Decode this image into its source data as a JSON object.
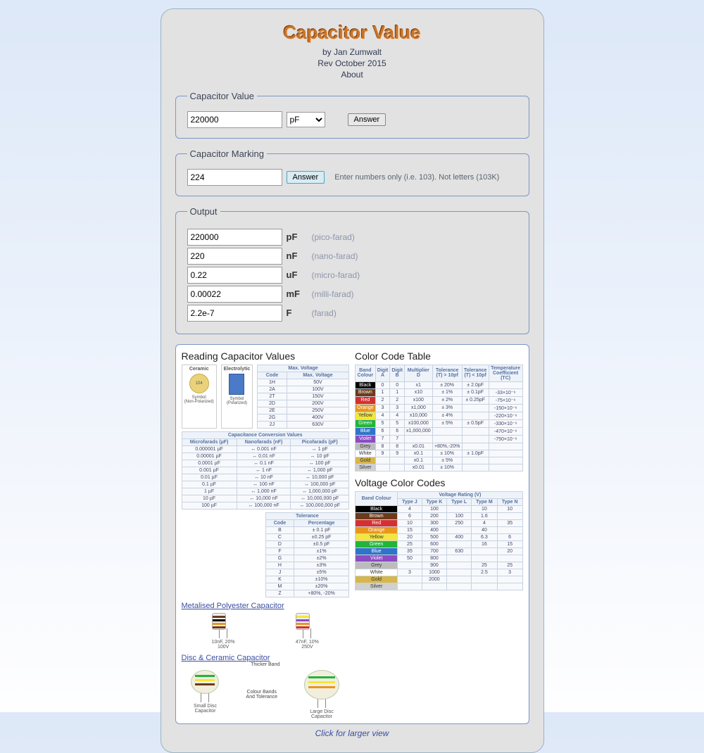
{
  "title": "Capacitor Value",
  "author": "by Jan Zumwalt",
  "rev": "Rev October 2015",
  "about": "About",
  "sections": {
    "value": {
      "legend": "Capacitor Value",
      "input": "220000",
      "unit_selected": "pF",
      "unit_options": [
        "pF",
        "nF",
        "uF",
        "mF",
        "F"
      ],
      "button": "Answer"
    },
    "marking": {
      "legend": "Capacitor Marking",
      "input": "224",
      "button": "Answer",
      "hint": "Enter numbers only (i.e. 103). Not letters (103K)"
    },
    "output": {
      "legend": "Output",
      "rows": [
        {
          "val": "220000",
          "unit": "pF",
          "desc": "(pico-farad)"
        },
        {
          "val": "220",
          "unit": "nF",
          "desc": "(nano-farad)"
        },
        {
          "val": "0.22",
          "unit": "uF",
          "desc": "(micro-farad)"
        },
        {
          "val": "0.00022",
          "unit": "mF",
          "desc": "(milli-farad)"
        },
        {
          "val": "2.2e-7",
          "unit": "F",
          "desc": "(farad)"
        }
      ]
    }
  },
  "reference": {
    "reading_heading": "Reading Capacitor Values",
    "colorcode_heading": "Color Code Table",
    "voltage_heading": "Voltage Color Codes",
    "link_poly": "Metalised Polyester Capacitor",
    "link_disc": "Disc & Ceramic Capacitor",
    "click_larger": "Click for larger view",
    "ceramic_label": "Ceramic",
    "electrolytic_label": "Electrolytic",
    "symbol_np": "Symbol\n(Non-Polarized)",
    "symbol_p": "Symbol\n(Polarized)",
    "maxv": {
      "title": "Max. Voltage",
      "cols": [
        "Code",
        "Max. Voltage"
      ],
      "rows": [
        [
          "1H",
          "50V"
        ],
        [
          "2A",
          "100V"
        ],
        [
          "2T",
          "150V"
        ],
        [
          "2D",
          "200V"
        ],
        [
          "2E",
          "250V"
        ],
        [
          "2G",
          "400V"
        ],
        [
          "2J",
          "630V"
        ]
      ]
    },
    "tolerance": {
      "title": "Tolerance",
      "cols": [
        "Code",
        "Percentage"
      ],
      "rows": [
        [
          "B",
          "± 0.1 pF"
        ],
        [
          "C",
          "±0.25 pF"
        ],
        [
          "D",
          "±0.5 pF"
        ],
        [
          "F",
          "±1%"
        ],
        [
          "G",
          "±2%"
        ],
        [
          "H",
          "±3%"
        ],
        [
          "J",
          "±5%"
        ],
        [
          "K",
          "±10%"
        ],
        [
          "M",
          "±20%"
        ],
        [
          "Z",
          "+80%, -20%"
        ]
      ]
    },
    "conversion": {
      "title": "Capacitance Conversion Values",
      "cols": [
        "Microfarads (µF)",
        "Nanofarads (nF)",
        "Picofarads (pF)"
      ],
      "rows": [
        [
          "0.000001 µF",
          "↔ 0.001 nF",
          "↔ 1 pF"
        ],
        [
          "0.00001 µF",
          "↔ 0.01 nF",
          "↔ 10 pF"
        ],
        [
          "0.0001 µF",
          "↔ 0.1 nF",
          "↔ 100 pF"
        ],
        [
          "0.001 µF",
          "↔ 1 nF",
          "↔ 1,000 pF"
        ],
        [
          "0.01 µF",
          "↔ 10 nF",
          "↔ 10,000 pF"
        ],
        [
          "0.1 µF",
          "↔ 100 nF",
          "↔ 100,000 pF"
        ],
        [
          "1 µF",
          "↔ 1,000 nF",
          "↔ 1,000,000 pF"
        ],
        [
          "10 µF",
          "↔ 10,000 nF",
          "↔ 10,000,000 pF"
        ],
        [
          "100 µF",
          "↔ 100,000 nF",
          "↔ 100,000,000 pF"
        ]
      ]
    },
    "colorcode": {
      "cols": [
        "Band Colour",
        "Digit A",
        "Digit B",
        "Multiplier D",
        "Tolerance (T) > 10pf",
        "Tolerance (T) < 10pf",
        "Temperature Coefficient (TC)"
      ],
      "rows": [
        {
          "class": "cc-black",
          "cells": [
            "Black",
            "0",
            "0",
            "x1",
            "± 20%",
            "± 2.0pF",
            ""
          ]
        },
        {
          "class": "cc-brown",
          "cells": [
            "Brown",
            "1",
            "1",
            "x10",
            "± 1%",
            "± 0.1pF",
            "-33×10⁻⁶"
          ]
        },
        {
          "class": "cc-red",
          "cells": [
            "Red",
            "2",
            "2",
            "x100",
            "± 2%",
            "± 0.25pF",
            "-75×10⁻⁶"
          ]
        },
        {
          "class": "cc-orange",
          "cells": [
            "Orange",
            "3",
            "3",
            "x1,000",
            "± 3%",
            "",
            "-150×10⁻⁶"
          ]
        },
        {
          "class": "cc-yellow",
          "cells": [
            "Yellow",
            "4",
            "4",
            "x10,000",
            "± 4%",
            "",
            "-220×10⁻⁶"
          ]
        },
        {
          "class": "cc-green",
          "cells": [
            "Green",
            "5",
            "5",
            "x100,000",
            "± 5%",
            "± 0.5pF",
            "-330×10⁻⁶"
          ]
        },
        {
          "class": "cc-blue",
          "cells": [
            "Blue",
            "6",
            "6",
            "x1,000,000",
            "",
            "",
            "-470×10⁻⁶"
          ]
        },
        {
          "class": "cc-violet",
          "cells": [
            "Violet",
            "7",
            "7",
            "",
            "",
            "",
            "-750×10⁻⁶"
          ]
        },
        {
          "class": "cc-grey",
          "cells": [
            "Grey",
            "8",
            "8",
            "x0.01",
            "+80%,-20%",
            "",
            ""
          ]
        },
        {
          "class": "cc-white",
          "cells": [
            "White",
            "9",
            "9",
            "x0.1",
            "± 10%",
            "± 1.0pF",
            ""
          ]
        },
        {
          "class": "cc-gold",
          "cells": [
            "Gold",
            "",
            "",
            "x0.1",
            "± 5%",
            "",
            ""
          ]
        },
        {
          "class": "cc-silver",
          "cells": [
            "Silver",
            "",
            "",
            "x0.01",
            "± 10%",
            "",
            ""
          ]
        }
      ]
    },
    "voltage": {
      "group_header": "Voltage Rating (V)",
      "cols": [
        "Band Colour",
        "Type J",
        "Type K",
        "Type L",
        "Type M",
        "Type N"
      ],
      "rows": [
        {
          "class": "cc-black",
          "cells": [
            "Black",
            "4",
            "100",
            "",
            "10",
            "10"
          ]
        },
        {
          "class": "cc-brown",
          "cells": [
            "Brown",
            "6",
            "200",
            "100",
            "1.6",
            ""
          ]
        },
        {
          "class": "cc-red",
          "cells": [
            "Red",
            "10",
            "300",
            "250",
            "4",
            "35"
          ]
        },
        {
          "class": "cc-orange",
          "cells": [
            "Orange",
            "15",
            "400",
            "",
            "40",
            ""
          ]
        },
        {
          "class": "cc-yellow",
          "cells": [
            "Yellow",
            "20",
            "500",
            "400",
            "6.3",
            "6"
          ]
        },
        {
          "class": "cc-green",
          "cells": [
            "Green",
            "25",
            "600",
            "",
            "16",
            "15"
          ]
        },
        {
          "class": "cc-blue",
          "cells": [
            "Blue",
            "35",
            "700",
            "630",
            "",
            "20"
          ]
        },
        {
          "class": "cc-violet",
          "cells": [
            "Violet",
            "50",
            "800",
            "",
            "",
            ""
          ]
        },
        {
          "class": "cc-grey",
          "cells": [
            "Grey",
            "",
            "900",
            "",
            "25",
            "25"
          ]
        },
        {
          "class": "cc-white",
          "cells": [
            "White",
            "3",
            "1000",
            "",
            "2.5",
            "3"
          ]
        },
        {
          "class": "cc-gold",
          "cells": [
            "Gold",
            "",
            "2000",
            "",
            "",
            ""
          ]
        },
        {
          "class": "cc-silver",
          "cells": [
            "Silver",
            "",
            "",
            "",
            "",
            ""
          ]
        }
      ]
    },
    "poly_examples": [
      {
        "caption": "10nF, 20%\n100V"
      },
      {
        "caption": "47nF, 10%\n250V"
      }
    ],
    "disc_labels": {
      "thicker": "Thicker Band",
      "middle": "Colour Bands\nAnd Tolerance",
      "small": "Small Disc\nCapacitor",
      "large": "Large Disc\nCapacitor"
    }
  }
}
